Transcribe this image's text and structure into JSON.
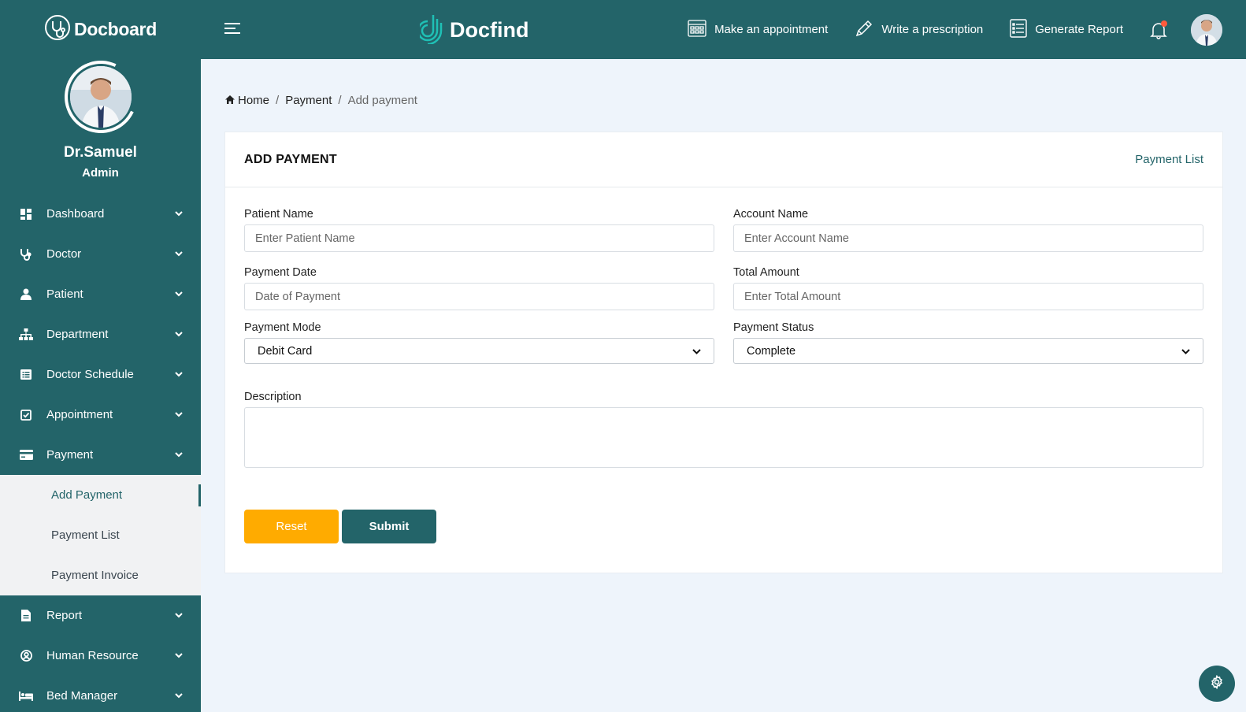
{
  "sidebar": {
    "brand": "Docboard",
    "profile": {
      "name": "Dr.Samuel",
      "role": "Admin"
    },
    "items": [
      {
        "label": "Dashboard",
        "icon": "dashboard-icon"
      },
      {
        "label": "Doctor",
        "icon": "stethoscope-icon"
      },
      {
        "label": "Patient",
        "icon": "person-icon"
      },
      {
        "label": "Department",
        "icon": "org-chart-icon"
      },
      {
        "label": "Doctor Schedule",
        "icon": "list-icon"
      },
      {
        "label": "Appointment",
        "icon": "checkbox-icon"
      },
      {
        "label": "Payment",
        "icon": "credit-card-icon"
      }
    ],
    "payment_sub": [
      {
        "label": "Add Payment",
        "active": true
      },
      {
        "label": "Payment List"
      },
      {
        "label": "Payment Invoice"
      }
    ],
    "items_after": [
      {
        "label": "Report",
        "icon": "document-icon"
      },
      {
        "label": "Human Resource",
        "icon": "user-circle-icon"
      },
      {
        "label": "Bed Manager",
        "icon": "bed-icon"
      }
    ]
  },
  "header": {
    "logo": "Docfind",
    "actions": [
      {
        "label": "Make an appointment",
        "icon": "calendar-grid-icon"
      },
      {
        "label": "Write a prescription",
        "icon": "pencil-icon"
      },
      {
        "label": "Generate Report",
        "icon": "report-list-icon"
      }
    ]
  },
  "breadcrumb": {
    "home": "Home",
    "parent": "Payment",
    "current": "Add payment",
    "sep": "/"
  },
  "card": {
    "title": "ADD PAYMENT",
    "link": "Payment List",
    "fields": {
      "patient_name": {
        "label": "Patient Name",
        "placeholder": "Enter Patient Name"
      },
      "account_name": {
        "label": "Account Name",
        "placeholder": "Enter Account Name"
      },
      "payment_date": {
        "label": "Payment Date",
        "placeholder": "Date of Payment"
      },
      "total_amount": {
        "label": "Total Amount",
        "placeholder": "Enter Total Amount"
      },
      "payment_mode": {
        "label": "Payment Mode",
        "value": "Debit Card"
      },
      "payment_status": {
        "label": "Payment Status",
        "value": "Complete"
      },
      "description": {
        "label": "Description"
      }
    },
    "buttons": {
      "reset": "Reset",
      "submit": "Submit"
    }
  },
  "colors": {
    "primary": "#236469",
    "accent": "#ffab00",
    "background": "#eef4fb"
  }
}
